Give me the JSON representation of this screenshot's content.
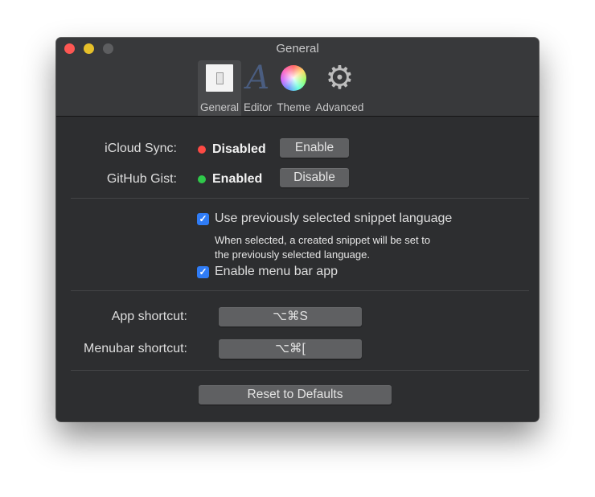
{
  "window": {
    "title": "General"
  },
  "tabs": [
    {
      "label": "General",
      "icon": "toggle-switch-icon",
      "active": true
    },
    {
      "label": "Editor",
      "icon": "font-a-icon",
      "active": false
    },
    {
      "label": "Theme",
      "icon": "color-wheel-icon",
      "active": false
    },
    {
      "label": "Advanced",
      "icon": "gear-icon",
      "active": false
    }
  ],
  "sync": {
    "icloud": {
      "label": "iCloud Sync:",
      "status": "Disabled",
      "status_color": "#fd4a44",
      "button": "Enable"
    },
    "gist": {
      "label": "GitHub Gist:",
      "status": "Enabled",
      "status_color": "#2fc94a",
      "button": "Disable"
    }
  },
  "options": {
    "snippet_language": {
      "label": "Use previously selected snippet language",
      "checked": true,
      "help_line1": "When selected, a created snippet will be set to",
      "help_line2": "the previously selected language."
    },
    "menu_bar_app": {
      "label": "Enable menu bar app",
      "checked": true
    }
  },
  "shortcuts": {
    "app": {
      "label": "App shortcut:",
      "value": "⌥⌘S"
    },
    "menubar": {
      "label": "Menubar shortcut:",
      "value": "⌥⌘["
    }
  },
  "reset_button": "Reset to Defaults",
  "check_glyph": "✓"
}
